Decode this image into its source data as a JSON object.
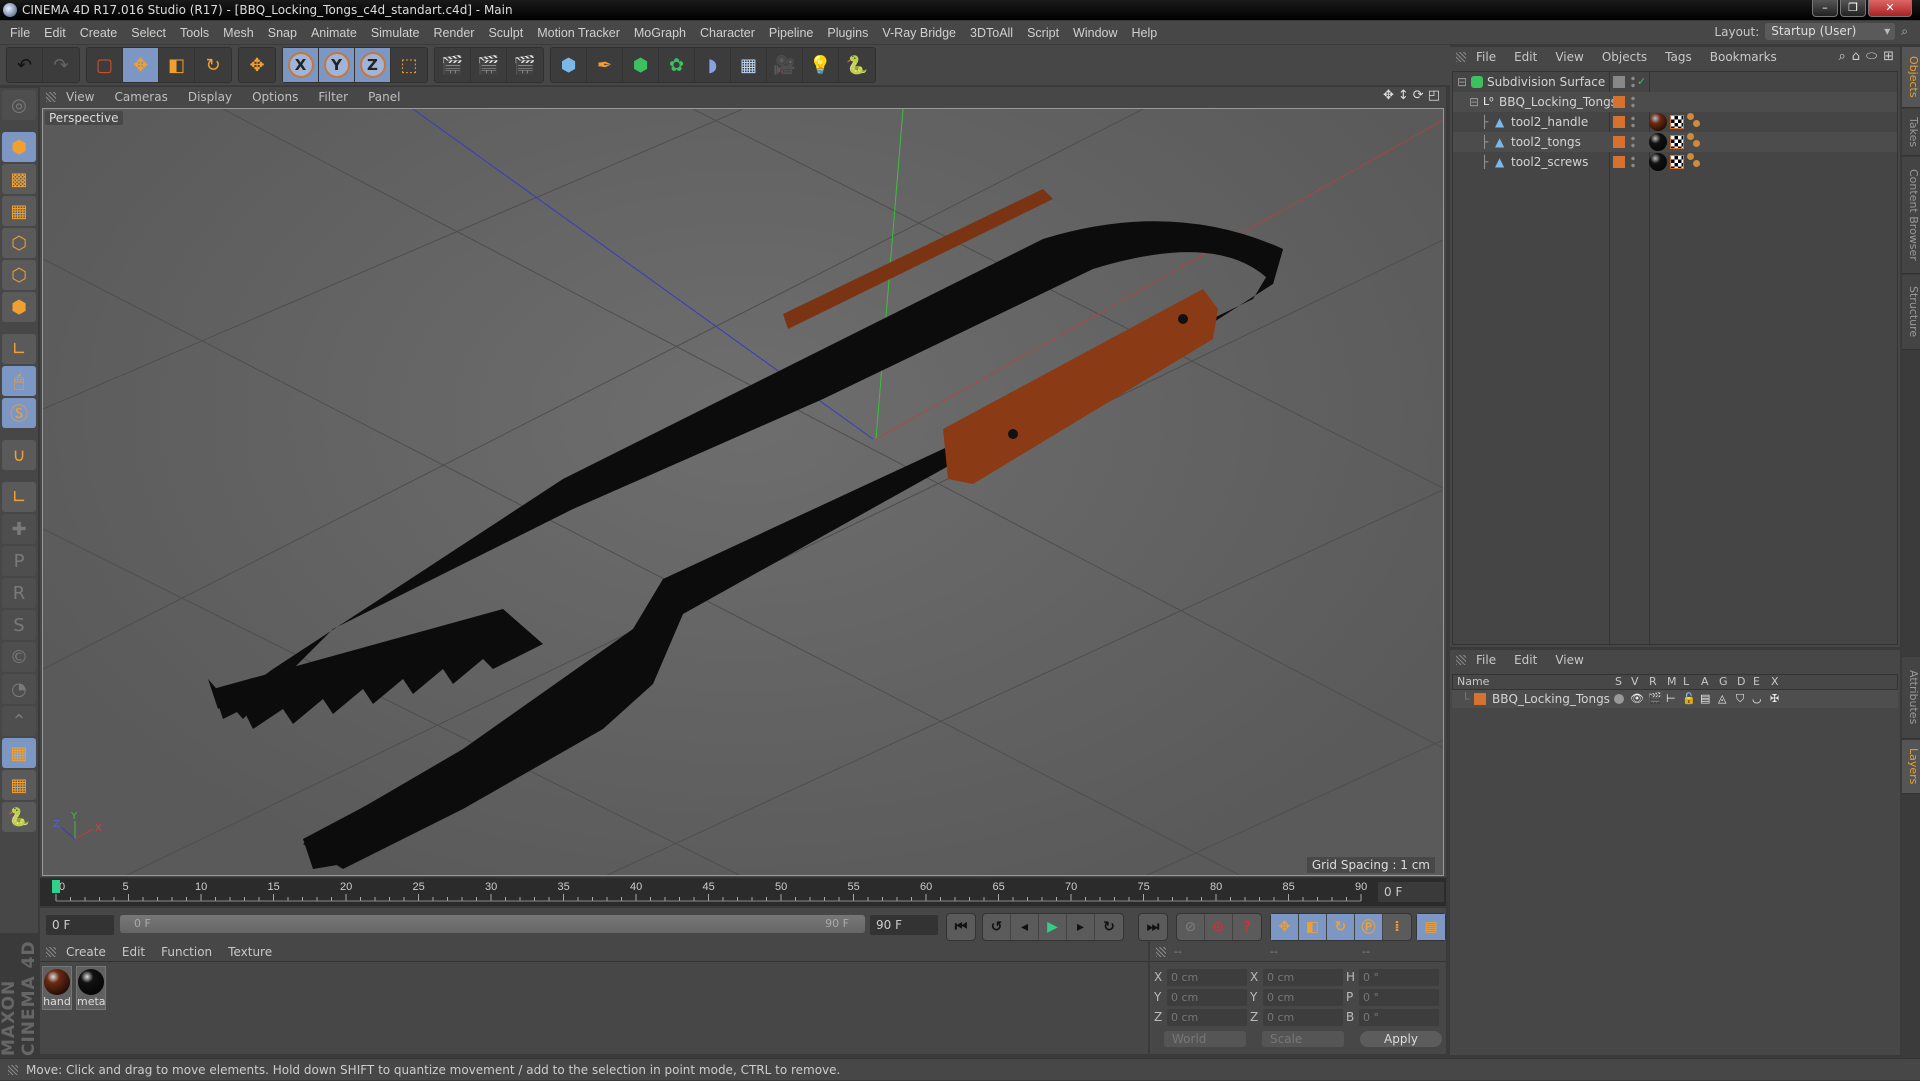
{
  "window": {
    "title": "CINEMA 4D R17.016 Studio (R17) - [BBQ_Locking_Tongs_c4d_standart.c4d] - Main",
    "controls": [
      "minimize",
      "restore",
      "close"
    ]
  },
  "menubar": {
    "items": [
      "File",
      "Edit",
      "Create",
      "Select",
      "Tools",
      "Mesh",
      "Snap",
      "Animate",
      "Simulate",
      "Render",
      "Sculpt",
      "Motion Tracker",
      "MoGraph",
      "Character",
      "Pipeline",
      "Plugins",
      "V-Ray Bridge",
      "3DToAll",
      "Script",
      "Window",
      "Help"
    ],
    "layout_label": "Layout:",
    "layout_value": "Startup (User)"
  },
  "toolbar": {
    "groups": [
      [
        "undo-icon",
        "redo-icon"
      ],
      [
        "live-selection-icon",
        "move-icon",
        "scale-icon",
        "rotate-icon"
      ],
      [
        "move-active-icon"
      ],
      [
        "x-axis-lock-icon",
        "y-axis-lock-icon",
        "z-axis-lock-icon",
        "coordinate-system-icon"
      ],
      [
        "render-view-icon",
        "render-picture-viewer-icon",
        "render-settings-icon"
      ],
      [
        "cube-icon",
        "pen-spline-icon",
        "subdivision-surface-icon",
        "cloner-icon",
        "deformer-icon",
        "floor-icon",
        "camera-icon",
        "light-icon",
        "python-icon"
      ]
    ],
    "axis_labels": [
      "X",
      "Y",
      "Z"
    ]
  },
  "left_tools": [
    {
      "icon": "make-editable-icon",
      "active": false
    },
    {
      "icon": "model-mode-icon",
      "active": true
    },
    {
      "icon": "texture-mode-icon",
      "active": false
    },
    {
      "icon": "workplane-mode-icon",
      "active": false
    },
    {
      "icon": "points-mode-icon",
      "active": false
    },
    {
      "icon": "edges-mode-icon",
      "active": false
    },
    {
      "icon": "polygons-mode-icon",
      "active": false
    },
    {
      "icon": "axis-mode-icon",
      "active": false
    },
    {
      "icon": "tweak-mode-icon",
      "active": true
    },
    {
      "icon": "solo-mode-icon",
      "active": true
    },
    {
      "icon": "snap-magnet-icon",
      "active": false
    },
    {
      "icon": "workplane-axis-icon",
      "active": false
    },
    {
      "icon": "add-keyframe-icon",
      "active": false
    },
    {
      "icon": "key-position-icon",
      "active": false
    },
    {
      "icon": "key-rotation-icon",
      "active": false
    },
    {
      "icon": "key-psr-icon",
      "active": false
    },
    {
      "icon": "key-parameter-icon",
      "active": false
    },
    {
      "icon": "key-pla-icon",
      "active": false
    },
    {
      "icon": "key-point-level-icon",
      "active": false
    },
    {
      "icon": "locked-workplane-icon",
      "active": true
    },
    {
      "icon": "planar-workplane-icon",
      "active": false
    },
    {
      "icon": "python-script-icon",
      "active": false
    }
  ],
  "viewport": {
    "menu": [
      "View",
      "Cameras",
      "Display",
      "Options",
      "Filter",
      "Panel"
    ],
    "camera_label": "Perspective",
    "grid_spacing": "Grid Spacing : 1 cm",
    "axis_gizmo": [
      "X",
      "Y",
      "Z"
    ],
    "colors": {
      "metal": "#0d0d0d",
      "wood": "#8a3a14",
      "x_axis": "#c83232",
      "y_axis": "#32b432",
      "z_axis": "#3232c8"
    }
  },
  "timeline": {
    "ticks": [
      0,
      5,
      10,
      15,
      20,
      25,
      30,
      35,
      40,
      45,
      50,
      55,
      60,
      65,
      70,
      75,
      80,
      85,
      90
    ],
    "current_frame": "0 F",
    "start_field": "0 F",
    "range_start": "0 F",
    "range_end": "90 F",
    "end_field": "90 F",
    "range_max": 90
  },
  "transport": {
    "buttons": [
      "go-to-start-icon",
      "prev-key-icon",
      "prev-frame-icon",
      "play-icon",
      "next-frame-icon",
      "next-key-icon",
      "go-to-end-icon"
    ],
    "record_buttons": [
      "motion-record-icon",
      "record-active-icon",
      "autokey-icon"
    ],
    "key_buttons": [
      "key-position-toggle-icon",
      "key-scale-toggle-icon",
      "key-rotation-toggle-icon",
      "key-parameter-toggle-icon",
      "key-pla-toggle-icon"
    ],
    "timeline_button": "timeline-window-icon"
  },
  "material_manager": {
    "menu": [
      "Create",
      "Edit",
      "Function",
      "Texture"
    ],
    "materials": [
      {
        "name": "hand",
        "color": "#6b2a12"
      },
      {
        "name": "meta",
        "color": "#111111"
      }
    ]
  },
  "branding": {
    "text": "MAXON CINEMA 4D"
  },
  "coordinates": {
    "headers": [
      "--",
      "--",
      "--"
    ],
    "rows": [
      {
        "a_label": "X",
        "a_value": "0 cm",
        "b_label": "X",
        "b_value": "0 cm",
        "c_label": "H",
        "c_value": "0 °"
      },
      {
        "a_label": "Y",
        "a_value": "0 cm",
        "b_label": "Y",
        "b_value": "0 cm",
        "c_label": "P",
        "c_value": "0 °"
      },
      {
        "a_label": "Z",
        "a_value": "0 cm",
        "b_label": "Z",
        "b_value": "0 cm",
        "c_label": "B",
        "c_value": "0 °"
      }
    ],
    "space_select": "World",
    "mode_select": "Scale",
    "apply_label": "Apply"
  },
  "object_manager": {
    "menu": [
      "File",
      "Edit",
      "View",
      "Objects",
      "Tags",
      "Bookmarks"
    ],
    "objects": [
      {
        "name": "Subdivision Surface",
        "indent": 0,
        "type": "subdivision"
      },
      {
        "name": "BBQ_Locking_Tongs",
        "indent": 1,
        "type": "null"
      },
      {
        "name": "tool2_handle",
        "indent": 2,
        "type": "polygon",
        "material": "#6b2a12"
      },
      {
        "name": "tool2_tongs",
        "indent": 2,
        "type": "polygon",
        "material": "#111111"
      },
      {
        "name": "tool2_screws",
        "indent": 2,
        "type": "polygon",
        "material": "#111111"
      }
    ]
  },
  "layer_manager": {
    "menu": [
      "File",
      "Edit",
      "View"
    ],
    "columns": [
      "Name",
      "S",
      "V",
      "R",
      "M",
      "L",
      "A",
      "G",
      "D",
      "E",
      "X"
    ],
    "layers": [
      {
        "name": "BBQ_Locking_Tongs",
        "color": "#d6722e"
      }
    ]
  },
  "side_tabs": {
    "top": [
      {
        "label": "Objects",
        "active": true
      },
      {
        "label": "Takes",
        "active": false
      },
      {
        "label": "Content Browser",
        "active": false
      },
      {
        "label": "Structure",
        "active": false
      }
    ],
    "bottom": [
      {
        "label": "Attributes",
        "active": false
      },
      {
        "label": "Layers",
        "active": true
      }
    ]
  },
  "status": {
    "text": "Move: Click and drag to move elements. Hold down SHIFT to quantize movement / add to the selection in point mode, CTRL to remove."
  }
}
